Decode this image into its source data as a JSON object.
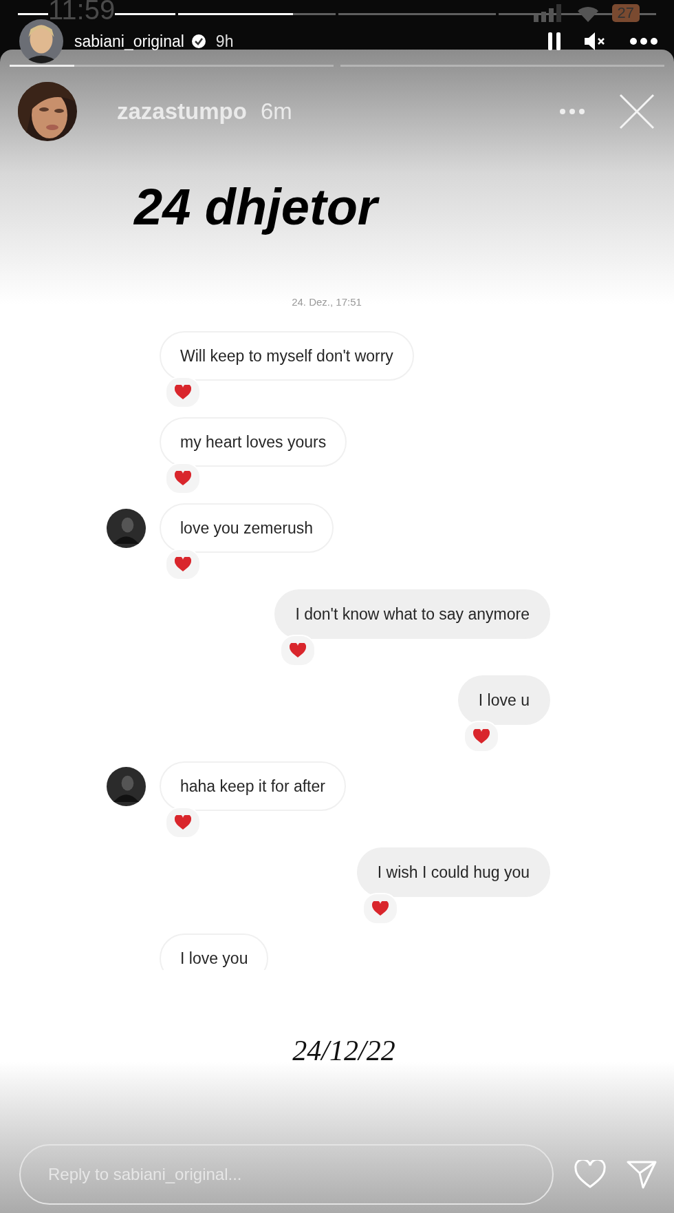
{
  "status_bar": {
    "time": "11:59",
    "battery": "27"
  },
  "story_progress": [
    {
      "kind": "viewed",
      "level": 1
    },
    {
      "kind": "current",
      "level": 0.73
    },
    {
      "kind": "upcoming"
    },
    {
      "kind": "upcoming"
    }
  ],
  "header": {
    "username": "sabiani_original",
    "verified": true,
    "age": "9h",
    "paused": true,
    "muted": true
  },
  "inner_story": {
    "progress": [
      {
        "kind": "current",
        "level": 0.2
      },
      {
        "kind": "upcoming"
      }
    ],
    "username": "zazastumpo",
    "age": "6m"
  },
  "title": "24 dhjetor",
  "chat": {
    "timestamp": "24. Dez., 17:51",
    "messages": [
      {
        "kind": "received",
        "text": "Will keep to myself don't worry",
        "avatar": false,
        "reacted": true
      },
      {
        "kind": "received",
        "text": "my heart loves yours",
        "avatar": false,
        "reacted": true
      },
      {
        "kind": "received",
        "text": "love you zemerush",
        "avatar": true,
        "reacted": true
      },
      {
        "kind": "sent",
        "text": "I don't know what to say anymore",
        "avatar": false,
        "reacted": true
      },
      {
        "kind": "sent",
        "text": "I love u",
        "avatar": false,
        "reacted": true
      },
      {
        "kind": "received",
        "text": "haha keep it for after",
        "avatar": true,
        "reacted": true
      },
      {
        "kind": "sent",
        "text": "I wish I could hug you",
        "avatar": false,
        "reacted": true
      },
      {
        "kind": "received",
        "text": "I love you",
        "avatar": false,
        "reacted": false
      }
    ]
  },
  "date_caption": "24/12/22",
  "reply": {
    "placeholder": "Reply to sabiani_original..."
  }
}
